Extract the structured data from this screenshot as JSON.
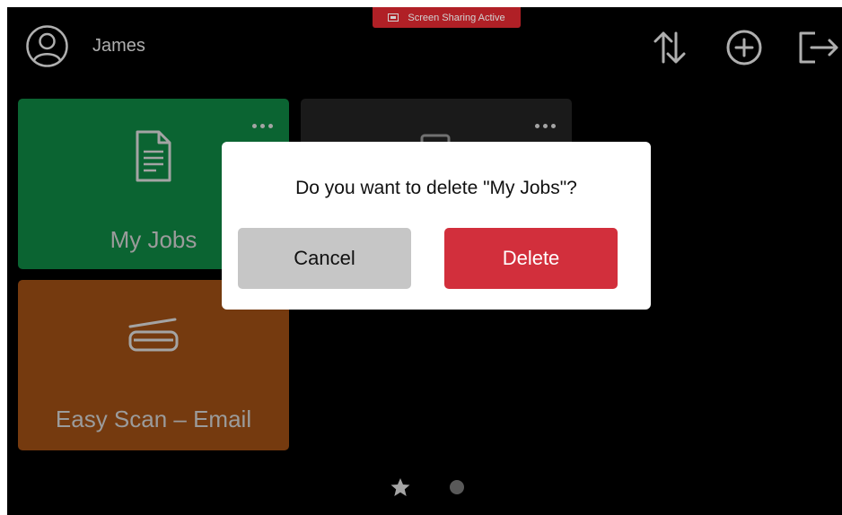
{
  "banner": {
    "text": "Screen Sharing Active",
    "color": "#d7282f",
    "icon": "screen-share-icon"
  },
  "header": {
    "user_icon": "user-circle-icon",
    "username": "James",
    "actions": [
      {
        "name": "sort-icon"
      },
      {
        "name": "add-icon"
      },
      {
        "name": "logout-icon"
      }
    ]
  },
  "tiles": [
    {
      "label": "My Jobs",
      "color": "#0e7a3e",
      "icon": "document-icon"
    },
    {
      "label": "",
      "color": "#202020",
      "icon": "device-icon"
    },
    {
      "label": "Easy Scan – Email",
      "color": "#8f4713",
      "icon": "scanner-icon"
    }
  ],
  "dialog": {
    "message": "Do you want to delete \"My Jobs\"?",
    "cancel_label": "Cancel",
    "delete_label": "Delete",
    "delete_color": "#d22f3c"
  },
  "pager": {
    "pages": [
      "favorites",
      "page-1"
    ],
    "active_index": 0
  }
}
